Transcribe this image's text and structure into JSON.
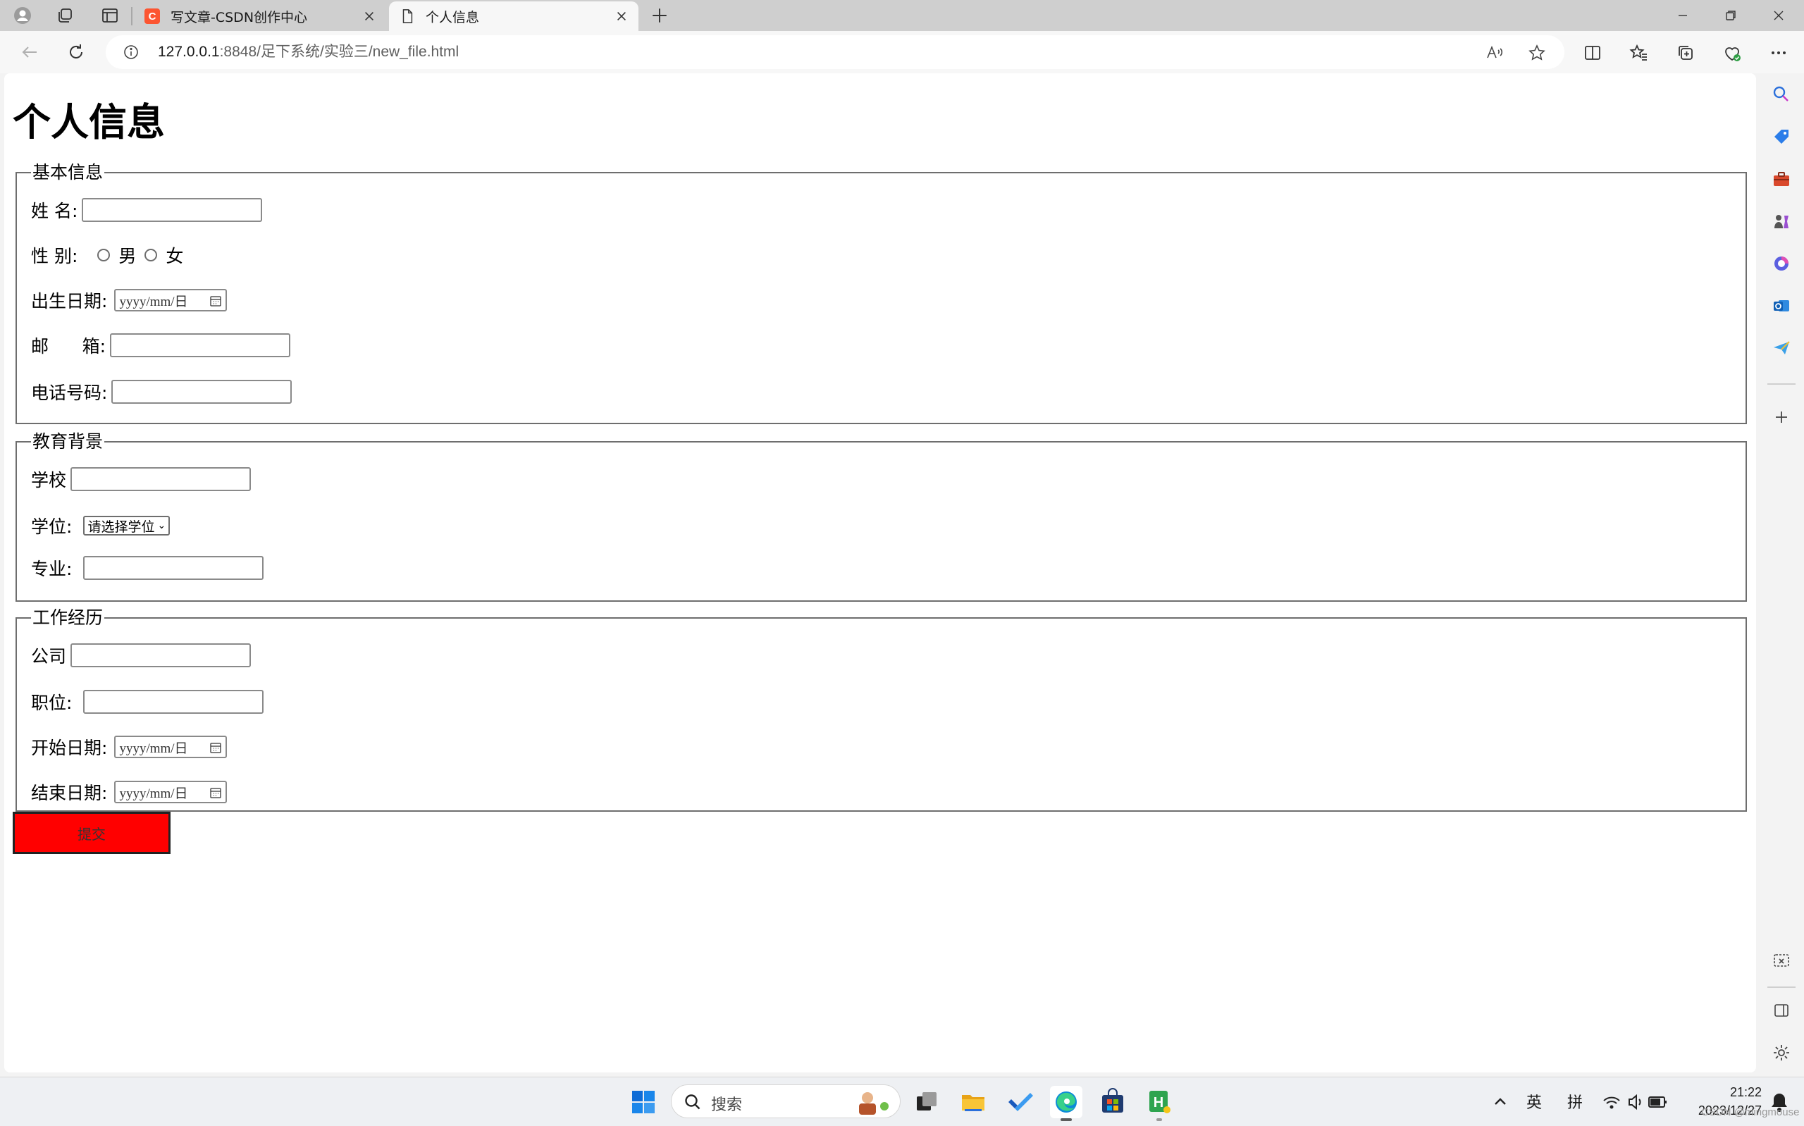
{
  "browser": {
    "tabs": [
      {
        "title": "写文章-CSDN创作中心",
        "active": false
      },
      {
        "title": "个人信息",
        "active": true
      }
    ],
    "url_host": "127.0.0.1",
    "url_rest": ":8848/足下系统/实验三/new_file.html"
  },
  "page": {
    "heading": "个人信息",
    "basic": {
      "legend": "基本信息",
      "name_label": "姓 名:",
      "gender_label": "性 别:",
      "gender_options": [
        "男",
        "女"
      ],
      "birth_label": "出生日期:",
      "birth_placeholder": "yyyy/mm/日",
      "email_label": "邮      箱:",
      "phone_label": "电话号码:"
    },
    "education": {
      "legend": "教育背景",
      "school_label": "学校",
      "degree_label": "学位:",
      "degree_selected": "请选择学位",
      "major_label": "专业:"
    },
    "work": {
      "legend": "工作经历",
      "company_label": "公司",
      "position_label": "职位:",
      "start_label": "开始日期:",
      "start_placeholder": "yyyy/mm/日",
      "end_label": "结束日期:",
      "end_placeholder": "yyyy/mm/日"
    },
    "submit_label": "提交",
    "submit_color": "#ff0000"
  },
  "taskbar": {
    "search_placeholder": "搜索",
    "ime_lang": "英",
    "ime_mode": "拼",
    "time": "21:22",
    "date": "2023/12/27"
  },
  "watermark": "CSDN @mingmouse"
}
